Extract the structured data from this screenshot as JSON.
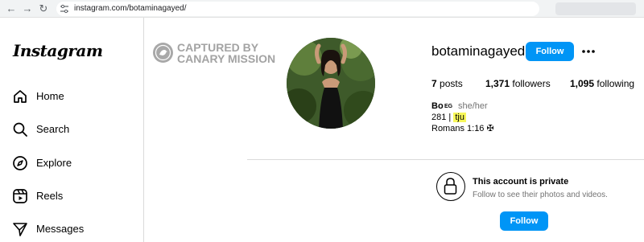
{
  "browser": {
    "url": "instagram.com/botaminagayed/"
  },
  "sidebar": {
    "logo": "Instagram",
    "items": [
      {
        "label": "Home",
        "icon": "home-icon"
      },
      {
        "label": "Search",
        "icon": "search-icon"
      },
      {
        "label": "Explore",
        "icon": "compass-icon"
      },
      {
        "label": "Reels",
        "icon": "reels-icon"
      },
      {
        "label": "Messages",
        "icon": "messages-icon"
      }
    ]
  },
  "watermark": {
    "line1": "CAPTURED BY",
    "line2": "CANARY MISSION"
  },
  "profile": {
    "username": "botaminagayed",
    "follow_label": "Follow",
    "stats": {
      "posts_count": "7",
      "posts_label": "posts",
      "followers_count": "1,371",
      "followers_label": "followers",
      "following_count": "1,095",
      "following_label": "following"
    },
    "bio": {
      "name": "Bo",
      "flag": "EG",
      "pronouns": "she/her",
      "line1_prefix": "281 | ",
      "line1_highlight": "tju",
      "line2": "Romans 1:16 ✠"
    }
  },
  "private": {
    "title": "This account is private",
    "subtitle": "Follow to see their photos and videos.",
    "follow_label": "Follow"
  },
  "colors": {
    "accent": "#0095f6",
    "highlight": "#f7f75a",
    "muted": "#737373"
  }
}
